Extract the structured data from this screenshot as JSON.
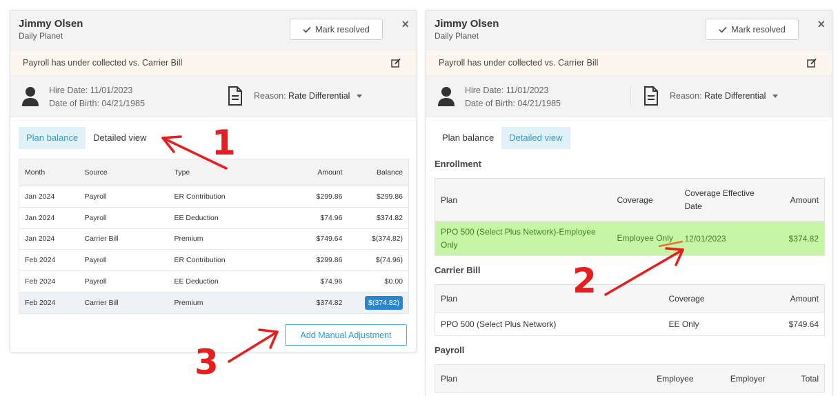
{
  "left_panel": {
    "person_name": "Jimmy Olsen",
    "company": "Daily Planet",
    "mark_resolved_label": "Mark resolved",
    "close_label": "×",
    "alert_text": "Payroll has under collected vs. Carrier Bill",
    "hire_date": "Hire Date: 11/01/2023",
    "dob": "Date of Birth: 04/21/1985",
    "reason_label": "Reason:",
    "reason_value": "Rate Differential",
    "tabs": [
      {
        "label": "Plan balance",
        "active": true
      },
      {
        "label": "Detailed view",
        "active": false
      }
    ],
    "table": {
      "headers": [
        "Month",
        "Source",
        "Type",
        "Amount",
        "Balance"
      ],
      "rows": [
        [
          "Jan 2024",
          "Payroll",
          "ER Contribution",
          "$299.86",
          "$299.86"
        ],
        [
          "Jan 2024",
          "Payroll",
          "EE Deduction",
          "$74.96",
          "$374.82"
        ],
        [
          "Jan 2024",
          "Carrier Bill",
          "Premium",
          "$749.64",
          "$(374.82)"
        ],
        [
          "Feb 2024",
          "Payroll",
          "ER Contribution",
          "$299.86",
          "$(74.96)"
        ],
        [
          "Feb 2024",
          "Payroll",
          "EE Deduction",
          "$74.96",
          "$0.00"
        ],
        [
          "Feb 2024",
          "Carrier Bill",
          "Premium",
          "$374.82",
          "$(374.82)"
        ]
      ]
    },
    "add_adjustment_label": "Add Manual Adjustment"
  },
  "right_panel": {
    "person_name": "Jimmy Olsen",
    "company": "Daily Planet",
    "mark_resolved_label": "Mark resolved",
    "close_label": "×",
    "alert_text": "Payroll has under collected vs. Carrier Bill",
    "hire_date": "Hire Date: 11/01/2023",
    "dob": "Date of Birth: 04/21/1985",
    "reason_label": "Reason:",
    "reason_value": "Rate Differential",
    "tabs": [
      {
        "label": "Plan balance",
        "active": false
      },
      {
        "label": "Detailed view",
        "active": true
      }
    ],
    "enrollment": {
      "title": "Enrollment",
      "headers": [
        "Plan",
        "Coverage",
        "Coverage Effective Date",
        "Amount"
      ],
      "row": [
        "PPO 500 (Select Plus Network)-Employee Only",
        "Employee Only",
        "12/01/2023",
        "$374.82"
      ]
    },
    "carrier_bill": {
      "title": "Carrier Bill",
      "headers": [
        "Plan",
        "Coverage",
        "Amount"
      ],
      "row": [
        "PPO 500 (Select Plus Network)",
        "EE Only",
        "$749.64"
      ]
    },
    "payroll": {
      "title": "Payroll",
      "headers": [
        "Plan",
        "Employee",
        "Employer",
        "Total"
      ]
    }
  },
  "annotations": {
    "one": "1",
    "two": "2",
    "three": "3"
  },
  "colors": {
    "accent": "#2a9cd1",
    "highlight_row": "#c6f6a5",
    "annotation": "#e81e1e",
    "badge": "#2c86cc"
  }
}
